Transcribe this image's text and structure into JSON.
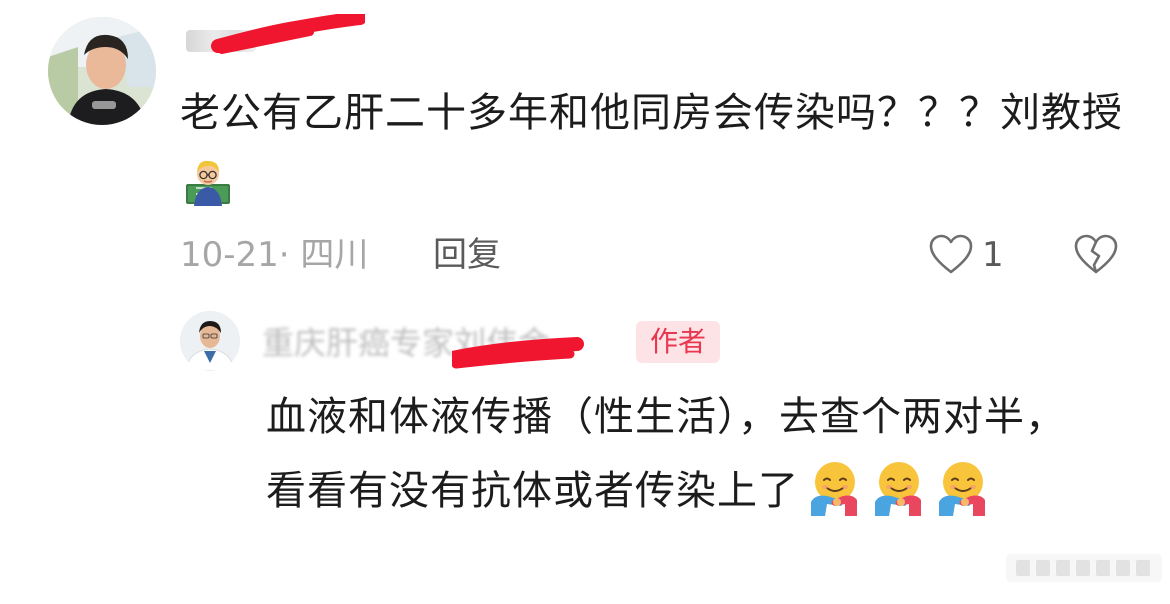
{
  "comment": {
    "avatar_icon": "user-avatar-photo",
    "username": "",
    "text": "老公有乙肝二十多年和他同房会传染吗？？？刘教授",
    "emoji": "teacher-emoji",
    "date_location": "10-21· 四川",
    "reply_label": "回复",
    "like_count": "1",
    "like_icon": "heart-outline-icon",
    "dislike_icon": "broken-heart-icon"
  },
  "reply": {
    "avatar_icon": "doctor-avatar-photo",
    "username": "重庆肝癌专家刘伟金",
    "badge": "作者",
    "text": "血液和体液传播（性生活），去查个两对半，看看有没有抗体或者传染上了",
    "emoji": "hugging-face-emoji",
    "badge_color": "#e8374f",
    "badge_bg": "#fde3e6"
  },
  "redaction_color": "#f0162f"
}
